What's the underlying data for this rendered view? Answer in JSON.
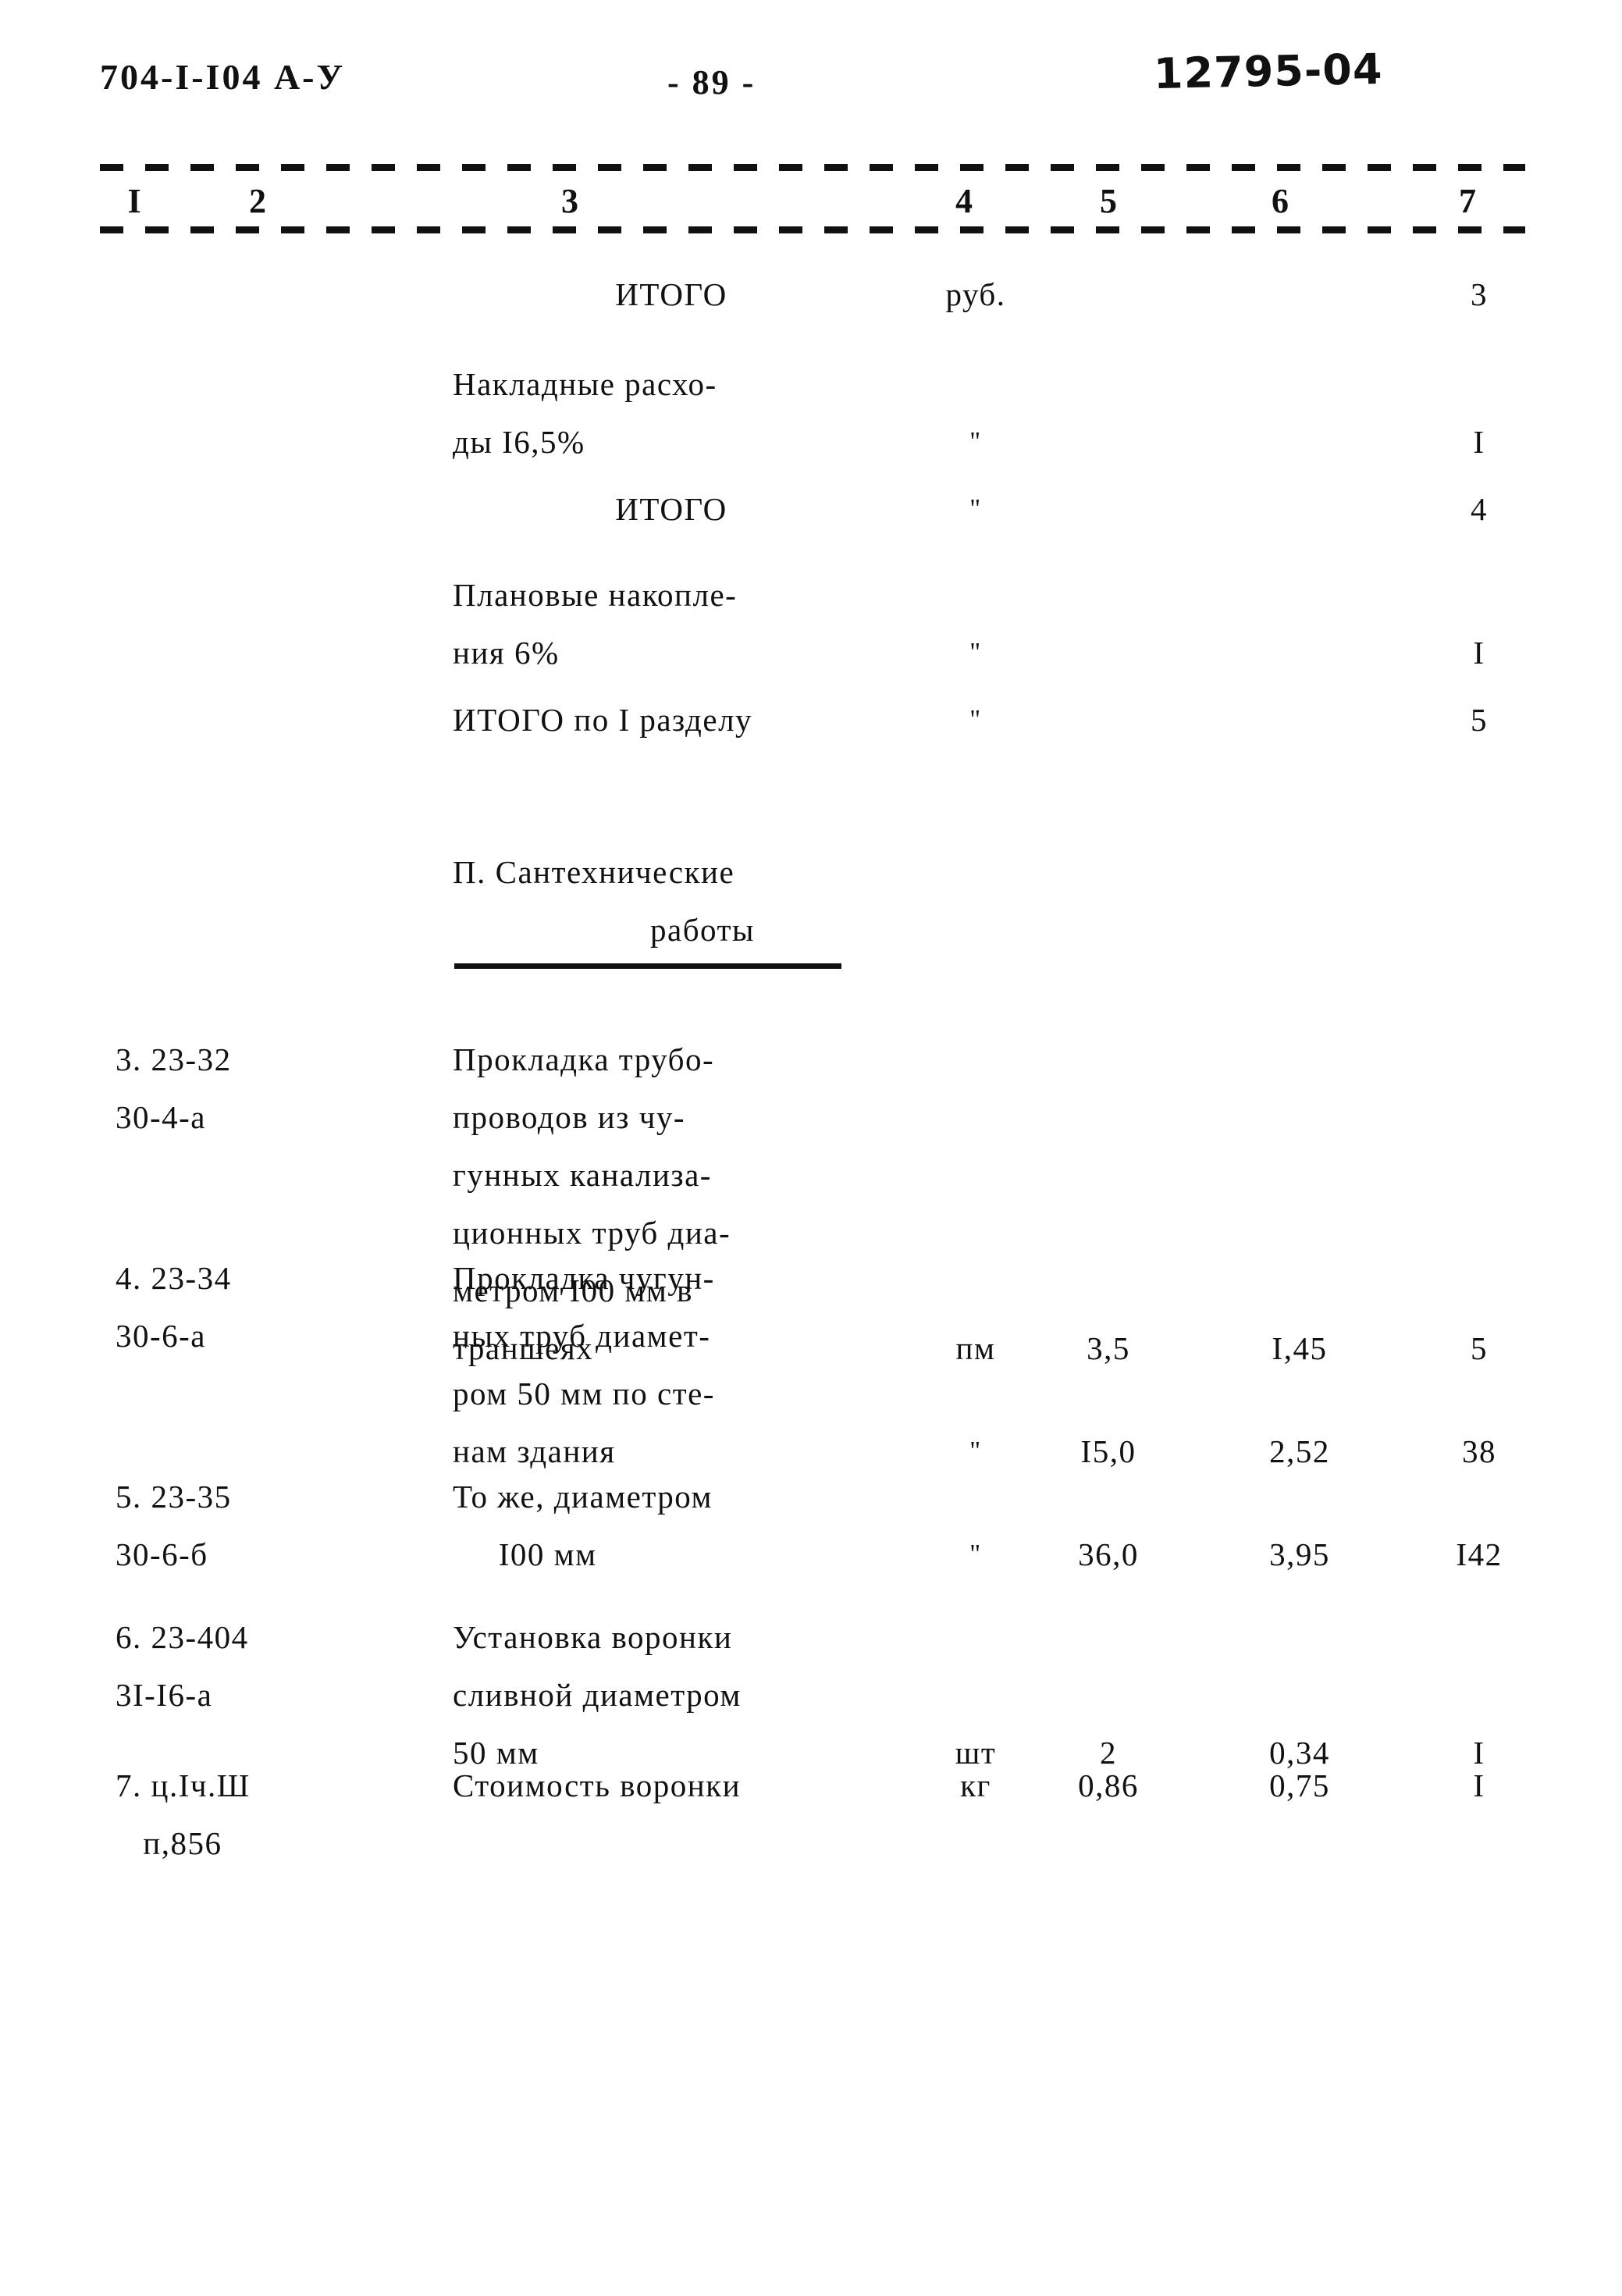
{
  "header": {
    "document_code": "704-I-I04  А-У",
    "page_label": "- 89 -",
    "stamp": "12795-04"
  },
  "table": {
    "column_numbers": [
      "I",
      "2",
      "3",
      "4",
      "5",
      "6",
      "7"
    ],
    "rows": [
      {
        "num": "",
        "desc": "ИТОГО",
        "desc_align": "center",
        "unit": "руб.",
        "qty": "",
        "price": "",
        "total": "3"
      },
      {
        "num": "",
        "desc": "Накладные расхо-\nды I6,5%",
        "desc_align": "left",
        "unit": "\"",
        "qty": "",
        "price": "",
        "total": "I"
      },
      {
        "num": "",
        "desc": "ИТОГО",
        "desc_align": "center",
        "unit": "\"",
        "qty": "",
        "price": "",
        "total": "4"
      },
      {
        "num": "",
        "desc": "Плановые накопле-\nния 6%",
        "desc_align": "left",
        "unit": "\"",
        "qty": "",
        "price": "",
        "total": "I"
      },
      {
        "num": "",
        "desc": "ИТОГО по I разделу",
        "desc_align": "left",
        "unit": "\"",
        "qty": "",
        "price": "",
        "total": "5"
      },
      {
        "num": "3. 23-32\n30-4-а",
        "desc": "Прокладка трубо-\nпроводов из чу-\nгунных канализа-\nционных труб диа-\nметром I00 мм в\nтраншеях",
        "desc_align": "left",
        "unit": "пм",
        "qty": "3,5",
        "price": "I,45",
        "total": "5"
      },
      {
        "num": "4. 23-34\n30-6-а",
        "desc": "Прокладка чугун-\nных труб диамет-\nром 50 мм по сте-\nнам здания",
        "desc_align": "left",
        "unit": "\"",
        "qty": "I5,0",
        "price": "2,52",
        "total": "38"
      },
      {
        "num": "5. 23-35\n30-6-б",
        "desc": "То же, диаметром\n     I00 мм",
        "desc_align": "left",
        "unit": "\"",
        "qty": "36,0",
        "price": "3,95",
        "total": "I42"
      },
      {
        "num": "6. 23-404\n3I-I6-а",
        "desc": "Установка воронки\nсливной диаметром\n50 мм",
        "desc_align": "left",
        "unit": "шт",
        "qty": "2",
        "price": "0,34",
        "total": "I"
      },
      {
        "num": "7. ц.Iч.Ш\n   п,856",
        "desc": "Стоимость воронки",
        "desc_align": "left",
        "unit": "кг",
        "qty": "0,86",
        "price": "0,75",
        "total": "I"
      }
    ],
    "section_heading": {
      "line1": "П. Сантехнические",
      "line2": "работы"
    }
  }
}
